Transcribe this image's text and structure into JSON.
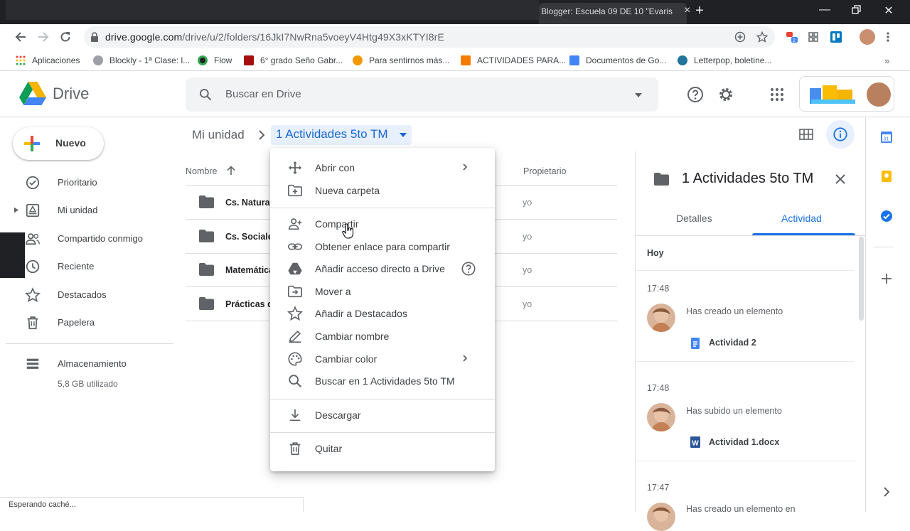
{
  "browser": {
    "tab_title": "Blogger: Escuela 09 DE 10 \"Evaris",
    "url_host": "drive.google.com",
    "url_path": "/drive/u/2/folders/16JkI7NwRna5voeyV4Htg49X3xKTYI8rE",
    "win_minimize": "—",
    "win_close": "✕"
  },
  "bookmarks": [
    {
      "label": "Aplicaciones",
      "color": "#ea4335"
    },
    {
      "label": "Blockly - 1ª Clase: l...",
      "color": "#9aa0a6"
    },
    {
      "label": "Flow",
      "color": "#202124"
    },
    {
      "label": "6° grado Seño Gabr...",
      "color": "#a50e0e"
    },
    {
      "label": "Para sentirnos más...",
      "color": "#f29900"
    },
    {
      "label": "ACTIVIDADES PARA...",
      "color": "#f57c00"
    },
    {
      "label": "Documentos de Go...",
      "color": "#4285f4"
    },
    {
      "label": "Letterpop, boletine...",
      "color": "#21759b"
    }
  ],
  "drive": {
    "brand": "Drive",
    "search_placeholder": "Buscar en Drive"
  },
  "sidebar": {
    "new_label": "Nuevo",
    "items": [
      {
        "label": "Prioritario",
        "icon": "check-circle-icon"
      },
      {
        "label": "Mi unidad",
        "icon": "my-drive-icon"
      },
      {
        "label": "Compartido conmigo",
        "icon": "shared-people-icon"
      },
      {
        "label": "Reciente",
        "icon": "clock-icon"
      },
      {
        "label": "Destacados",
        "icon": "star-icon"
      },
      {
        "label": "Papelera",
        "icon": "trash-icon"
      }
    ],
    "storage_label": "Almacenamiento",
    "storage_used": "5,8 GB utilizado"
  },
  "breadcrumb": {
    "root": "Mi unidad",
    "current": "1 Actividades 5to TM"
  },
  "list": {
    "col_name": "Nombre",
    "col_owner": "Propietario",
    "rows": [
      {
        "name": "Cs. Naturales",
        "owner": "yo"
      },
      {
        "name": "Cs. Sociales",
        "owner": "yo"
      },
      {
        "name": "Matemática",
        "owner": "yo"
      },
      {
        "name": "Prácticas del Lenguaje",
        "owner": "yo"
      }
    ]
  },
  "menu": {
    "items": [
      {
        "label": "Abrir con",
        "icon": "move-arrows-icon"
      },
      {
        "label": "Nueva carpeta",
        "icon": "new-folder-icon"
      },
      {
        "label": "Compartir",
        "icon": "add-person-icon"
      },
      {
        "label": "Obtener enlace para compartir",
        "icon": "link-icon"
      },
      {
        "label": "Añadir acceso directo a Drive",
        "icon": "drive-shortcut-icon"
      },
      {
        "label": "Mover a",
        "icon": "move-to-folder-icon"
      },
      {
        "label": "Añadir a Destacados",
        "icon": "star-outline-icon"
      },
      {
        "label": "Cambiar nombre",
        "icon": "pencil-icon"
      },
      {
        "label": "Cambiar color",
        "icon": "palette-icon"
      },
      {
        "label": "Buscar en 1 Actividades 5to TM",
        "icon": "search-icon"
      },
      {
        "label": "Descargar",
        "icon": "download-icon"
      },
      {
        "label": "Quitar",
        "icon": "trash-icon"
      }
    ]
  },
  "details": {
    "title": "1 Actividades 5to TM",
    "tab_details": "Detalles",
    "tab_activity": "Actividad",
    "today": "Hoy",
    "activities": [
      {
        "time": "17:48",
        "text": "Has creado un elemento",
        "file": "Actividad 2",
        "file_icon": "google-doc-icon"
      },
      {
        "time": "17:48",
        "text": "Has subido un elemento",
        "file": "Actividad 1.docx",
        "file_icon": "word-doc-icon"
      },
      {
        "time": "17:47",
        "text": "Has creado un elemento en",
        "file": "",
        "file_icon": ""
      }
    ]
  },
  "status_bar": "Esperando caché...",
  "colors": {
    "accent": "#1a73e8",
    "drive_green": "#0f9d58",
    "drive_yellow": "#f4b400",
    "drive_blue": "#4285f4",
    "drive_red": "#db4437"
  }
}
